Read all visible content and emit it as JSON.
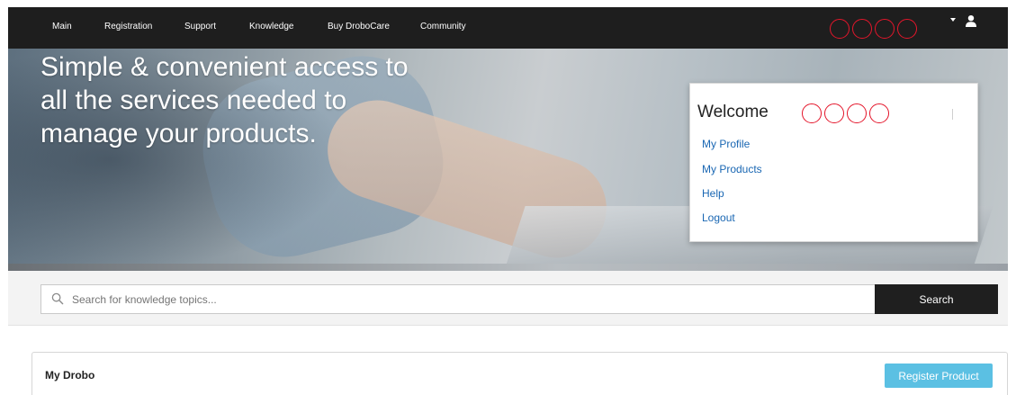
{
  "nav": {
    "items": [
      {
        "label": "Main"
      },
      {
        "label": "Registration"
      },
      {
        "label": "Support"
      },
      {
        "label": "Knowledge"
      },
      {
        "label": "Buy DroboCare"
      },
      {
        "label": "Community"
      }
    ],
    "user_icon": "user-icon",
    "dropdown_icon": "caret-down-icon"
  },
  "hero": {
    "headline": "Simple & convenient access to all the services needed to manage your products."
  },
  "welcome_menu": {
    "title": "Welcome",
    "links": [
      {
        "label": "My Profile"
      },
      {
        "label": "My Products"
      },
      {
        "label": "Help"
      },
      {
        "label": "Logout"
      }
    ]
  },
  "search": {
    "placeholder": "Search for knowledge topics...",
    "button_label": "Search",
    "icon": "search-icon"
  },
  "my_drobo": {
    "title": "My Drobo",
    "register_label": "Register Product"
  },
  "colors": {
    "nav_bg": "#1e1e1e",
    "link": "#1a67b3",
    "register_button": "#5bc0e3",
    "redaction_circle": "#e4162b"
  }
}
